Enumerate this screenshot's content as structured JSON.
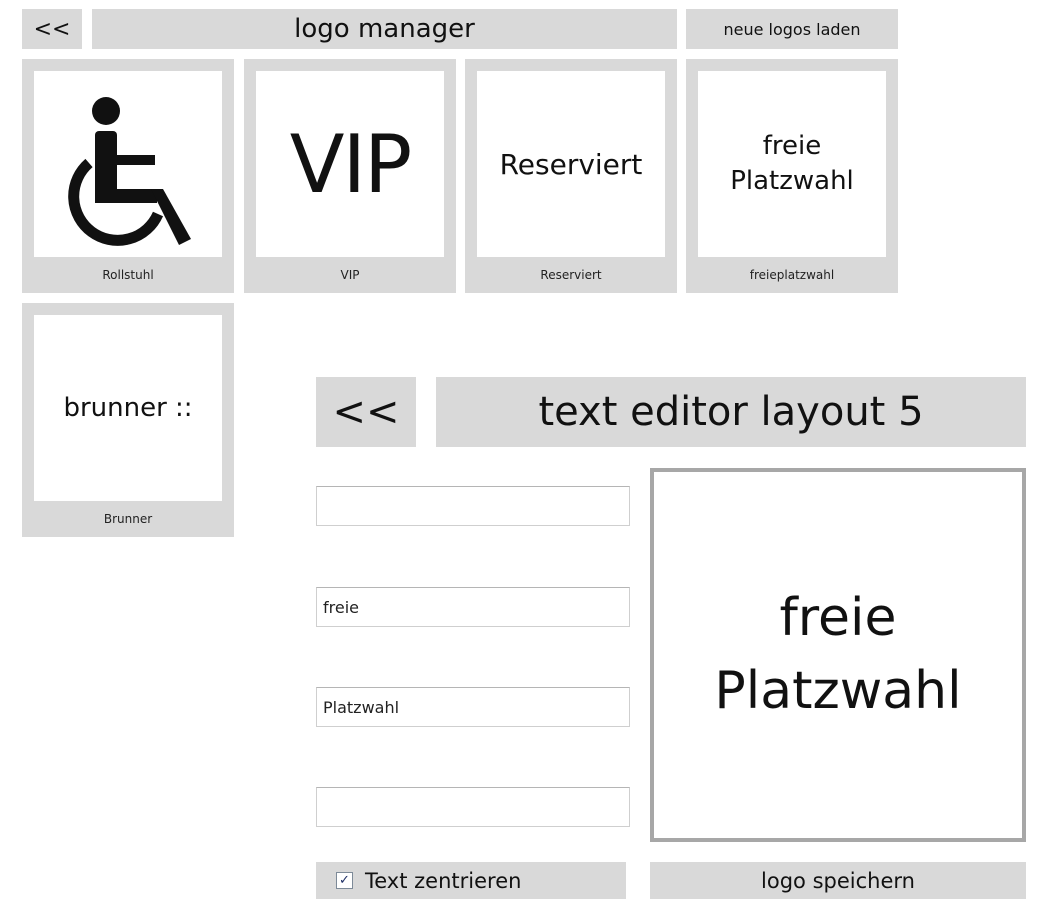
{
  "logo_manager": {
    "back_label": "<<",
    "title": "logo manager",
    "load_label": "neue logos laden",
    "logos": [
      {
        "name": "Rollstuhl",
        "icon": "wheelchair-icon"
      },
      {
        "name": "VIP",
        "text": "VIP"
      },
      {
        "name": "Reserviert",
        "text": "Reserviert"
      },
      {
        "name": "freieplatzwahl",
        "line1": "freie",
        "line2": "Platzwahl"
      },
      {
        "name": "Brunner",
        "text": "brunner ::"
      }
    ]
  },
  "text_editor": {
    "back_label": "<<",
    "title": "text editor layout 5",
    "fields": [
      "",
      "freie",
      "Platzwahl",
      ""
    ],
    "center_checkbox": {
      "label": "Text zentrieren",
      "checked": true
    },
    "preview": {
      "line1": "freie",
      "line2": "Platzwahl"
    },
    "save_label": "logo speichern"
  }
}
